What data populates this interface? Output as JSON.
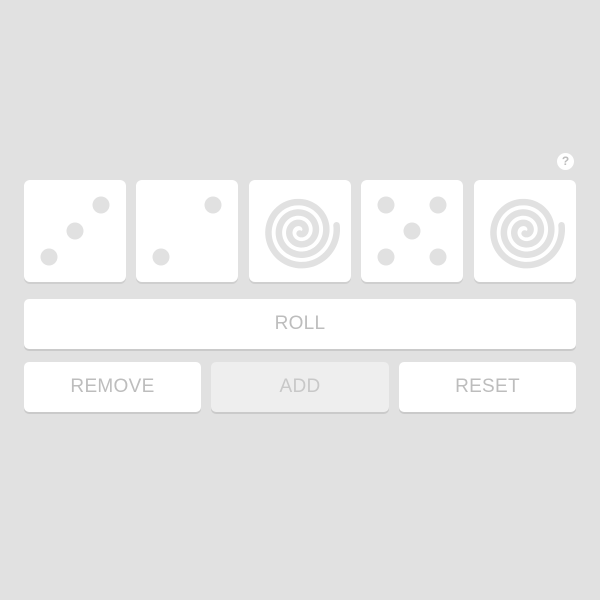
{
  "help": {
    "label": "?"
  },
  "dice": [
    {
      "face": 3,
      "kind": "pips"
    },
    {
      "face": 2,
      "kind": "pips"
    },
    {
      "face": "spiral",
      "kind": "spiral"
    },
    {
      "face": 5,
      "kind": "pips"
    },
    {
      "face": "spiral",
      "kind": "spiral"
    }
  ],
  "buttons": {
    "roll": "ROLL",
    "remove": "REMOVE",
    "add": "ADD",
    "reset": "RESET"
  },
  "colors": {
    "background": "#e1e1e1",
    "die": "#ffffff",
    "pip": "#e1e1e1",
    "text": "#bdbdbd",
    "disabled_button": "#eeeeee"
  }
}
